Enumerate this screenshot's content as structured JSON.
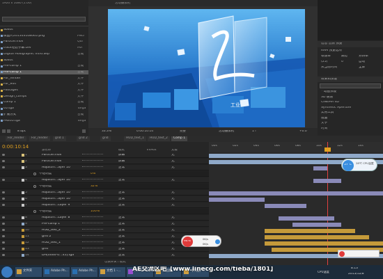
{
  "project": {
    "info_line": "1920 x 1080 (1.00)",
    "items": [
      {
        "name": "Solids",
        "type": ""
      },
      {
        "name": "微图片201503108065.png",
        "type": "PNG"
      },
      {
        "name": "Particle.mov",
        "type": "Qui"
      },
      {
        "name": "track经验字幕.Lev",
        "type": "AVI"
      },
      {
        "name": "Digital Holographic Intro.aep",
        "type": "合成"
      },
      {
        "name": "Solids",
        "type": ""
      },
      {
        "name": "Pre-comp 1",
        "type": "合成"
      },
      {
        "name": "Pre-comp 1",
        "type": "合成"
      },
      {
        "name": "For_render",
        "type": "文件"
      },
      {
        "name": "For_edit",
        "type": "文件"
      },
      {
        "name": "Footages",
        "type": "文件"
      },
      {
        "name": "Design_comps",
        "type": "文件"
      },
      {
        "name": "Comp 1",
        "type": "合成"
      },
      {
        "name": "05.tga",
        "type": "Targa"
      },
      {
        "name": "扩展方式",
        "type": "合成"
      },
      {
        "name": "PRE05.tga",
        "type": "Targa"
      }
    ],
    "bpc": "8 bpc"
  },
  "viewer": {
    "tab_label": "活动摄像机",
    "zoom": "33.3%",
    "timecode": "0:00:10:14",
    "quality": "完整",
    "camera": "活动摄像机",
    "views": "1个",
    "offset": "+0.0"
  },
  "right_panel": {
    "tab": "信息 音频 预览",
    "preview_label": "RAM 预览选项",
    "fps_label": "帧速率",
    "skip_label": "跳过",
    "res_label": "分辨率",
    "fps_value": "(25)",
    "skip_value": "0",
    "res_value": "自动",
    "from_current": "从当前时间",
    "full_screen": "全屏",
    "effects_tab": "效果和预设",
    "effects": [
      "* 动画预设",
      "3D 通道",
      "CINEMA 4D",
      "Synthetic Aperture",
      "实用工具",
      "扭曲",
      "文字",
      "时间"
    ]
  },
  "timeline": {
    "tabs": [
      "For_render",
      "For_render",
      "grid 1",
      "grid 2",
      "grid",
      "HUD_text_1",
      "HUD_text_2",
      "Comp 1"
    ],
    "current_time": "0:00:10:14",
    "columns": {
      "mode": "模式",
      "trkmat": "TrkMat",
      "parent": "父级",
      "name": "源名称"
    },
    "ruler": [
      "00s",
      "02s",
      "04s",
      "06s",
      "08s",
      "10s",
      "12s",
      "14s"
    ],
    "layers": [
      {
        "num": "1",
        "name": "Particle.mov",
        "mode": "屏幕",
        "parent": "无",
        "color": "#d9c27a"
      },
      {
        "num": "2",
        "name": "Particle.mov",
        "mode": "屏幕",
        "parent": "无",
        "color": "#d9c27a"
      },
      {
        "num": "3",
        "name": "Adjustm...ayer 10",
        "mode": "正常",
        "parent": "无",
        "color": "#c8c8c8"
      },
      {
        "num": "",
        "name": "不透明度",
        "mode": "0%",
        "parent": "",
        "color": ""
      },
      {
        "num": "4",
        "name": "Adjustm...ayer 10",
        "mode": "正常",
        "parent": "无",
        "color": "#c8c8c8"
      },
      {
        "num": "",
        "name": "不透明度",
        "mode": "32%",
        "parent": "",
        "color": ""
      },
      {
        "num": "5",
        "name": "Adjustm...ayer 10",
        "mode": "正常",
        "parent": "无",
        "color": "#c8c8c8"
      },
      {
        "num": "6",
        "name": "Adjustm...ayer 10",
        "mode": "正常",
        "parent": "无",
        "color": "#c8c8c8"
      },
      {
        "num": "7",
        "name": "Adjustm...Layer 9",
        "mode": "正常",
        "parent": "无",
        "color": "#c8c8c8"
      },
      {
        "num": "",
        "name": "不透明度",
        "mode": "100%",
        "parent": "",
        "color": ""
      },
      {
        "num": "8",
        "name": "Adjustm...Layer 8",
        "mode": "正常",
        "parent": "无",
        "color": "#c8c8c8"
      },
      {
        "num": "9",
        "name": "Pre-comp 1",
        "mode": "正常",
        "parent": "无",
        "color": "#8fa9c9"
      },
      {
        "num": "10",
        "name": "HUD_text_2",
        "mode": "正常",
        "parent": "无",
        "color": "#c59a3a"
      },
      {
        "num": "11",
        "name": "grid 2",
        "mode": "正常",
        "parent": "无",
        "color": "#c59a3a"
      },
      {
        "num": "12",
        "name": "HUD_text_1",
        "mode": "正常",
        "parent": "无",
        "color": "#c59a3a"
      },
      {
        "num": "13",
        "name": "grid",
        "mode": "正常",
        "parent": "无",
        "color": "#c59a3a"
      },
      {
        "num": "14",
        "name": "DH[0000-0...35].tga",
        "mode": "正常",
        "parent": "无",
        "color": "#8fa9c9"
      }
    ],
    "toggle_label": "切换开关 / 模式"
  },
  "widgets": {
    "cpu_temp_1": "57℃",
    "cpu_label_1": "28℃ CPU温度",
    "cpu_pct": "94%",
    "net_up": "0K/s",
    "net_down": "0K/s"
  },
  "taskbar": {
    "tasks": [
      "文件夹",
      "Adobe Ph...",
      "Adobe Ph...",
      "文档 1 -...",
      "Adobe Af...",
      "作品集",
      "【作品】..."
    ],
    "watermark": "AE交流区吧【www.linecg.com/tieba/1801】",
    "cpu_label": "CPU温度",
    "time": "8:13",
    "date": "2015/12/8"
  }
}
